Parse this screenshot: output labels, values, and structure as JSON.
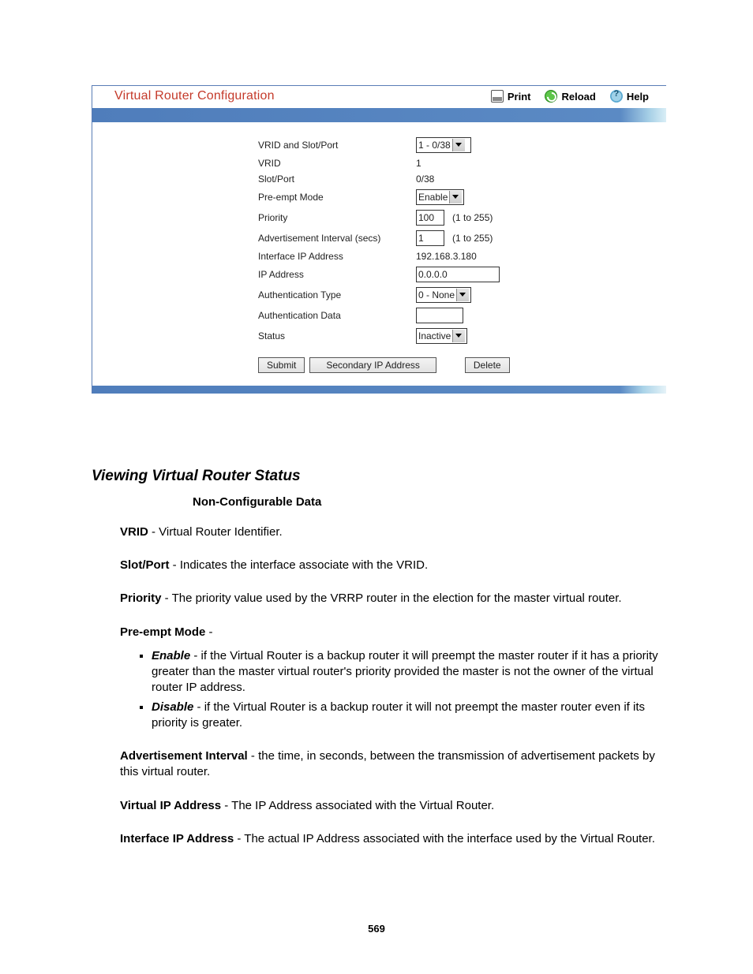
{
  "panel": {
    "title": "Virtual Router Configuration",
    "actions": {
      "print": "Print",
      "reload": "Reload",
      "help": "Help"
    }
  },
  "form": {
    "vrid_slot_port": {
      "label": "VRID and Slot/Port",
      "value": "1 - 0/38"
    },
    "vrid": {
      "label": "VRID",
      "value": "1"
    },
    "slot_port": {
      "label": "Slot/Port",
      "value": "0/38"
    },
    "preempt": {
      "label": "Pre-empt Mode",
      "value": "Enable"
    },
    "priority": {
      "label": "Priority",
      "value": "100",
      "hint": "(1 to 255)"
    },
    "adv": {
      "label": "Advertisement Interval (secs)",
      "value": "1",
      "hint": "(1 to 255)"
    },
    "iface_ip": {
      "label": "Interface IP Address",
      "value": "192.168.3.180"
    },
    "ip": {
      "label": "IP Address",
      "value": "0.0.0.0"
    },
    "auth_type": {
      "label": "Authentication Type",
      "value": "0 - None"
    },
    "auth_data": {
      "label": "Authentication Data",
      "value": ""
    },
    "status": {
      "label": "Status",
      "value": "Inactive"
    },
    "buttons": {
      "submit": "Submit",
      "secondary": "Secondary IP Address",
      "delete": "Delete"
    }
  },
  "prose": {
    "h2": "Viewing Virtual Router Status",
    "sub": "Non-Configurable Data",
    "vrid": {
      "term": "VRID",
      "desc": " - Virtual Router Identifier."
    },
    "slot": {
      "term": "Slot/Port",
      "desc": " - Indicates the interface associate with the VRID."
    },
    "priority": {
      "term": "Priority",
      "desc": " - The priority value used by the VRRP router in the election for the master virtual router."
    },
    "preempt_term": "Pre-empt Mode",
    "preempt_dash": " -",
    "enable": {
      "term": "Enable",
      "desc": " - if the Virtual Router is a backup router it will preempt the master router if it has a priority greater than the master virtual router's priority provided the master is not the owner of the virtual router IP address."
    },
    "disable": {
      "term": "Disable",
      "desc": " - if the Virtual Router is a backup router it will not preempt the master router even if its priority is greater."
    },
    "adv": {
      "term": "Advertisement Interval",
      "desc": " - the time, in seconds, between the transmission of advertisement packets by this virtual router."
    },
    "vip": {
      "term": "Virtual IP Address",
      "desc": " - The IP Address associated with the Virtual Router."
    },
    "iip": {
      "term": "Interface IP Address",
      "desc": " - The actual IP Address associated with the interface used by the Virtual Router."
    }
  },
  "page_number": "569"
}
